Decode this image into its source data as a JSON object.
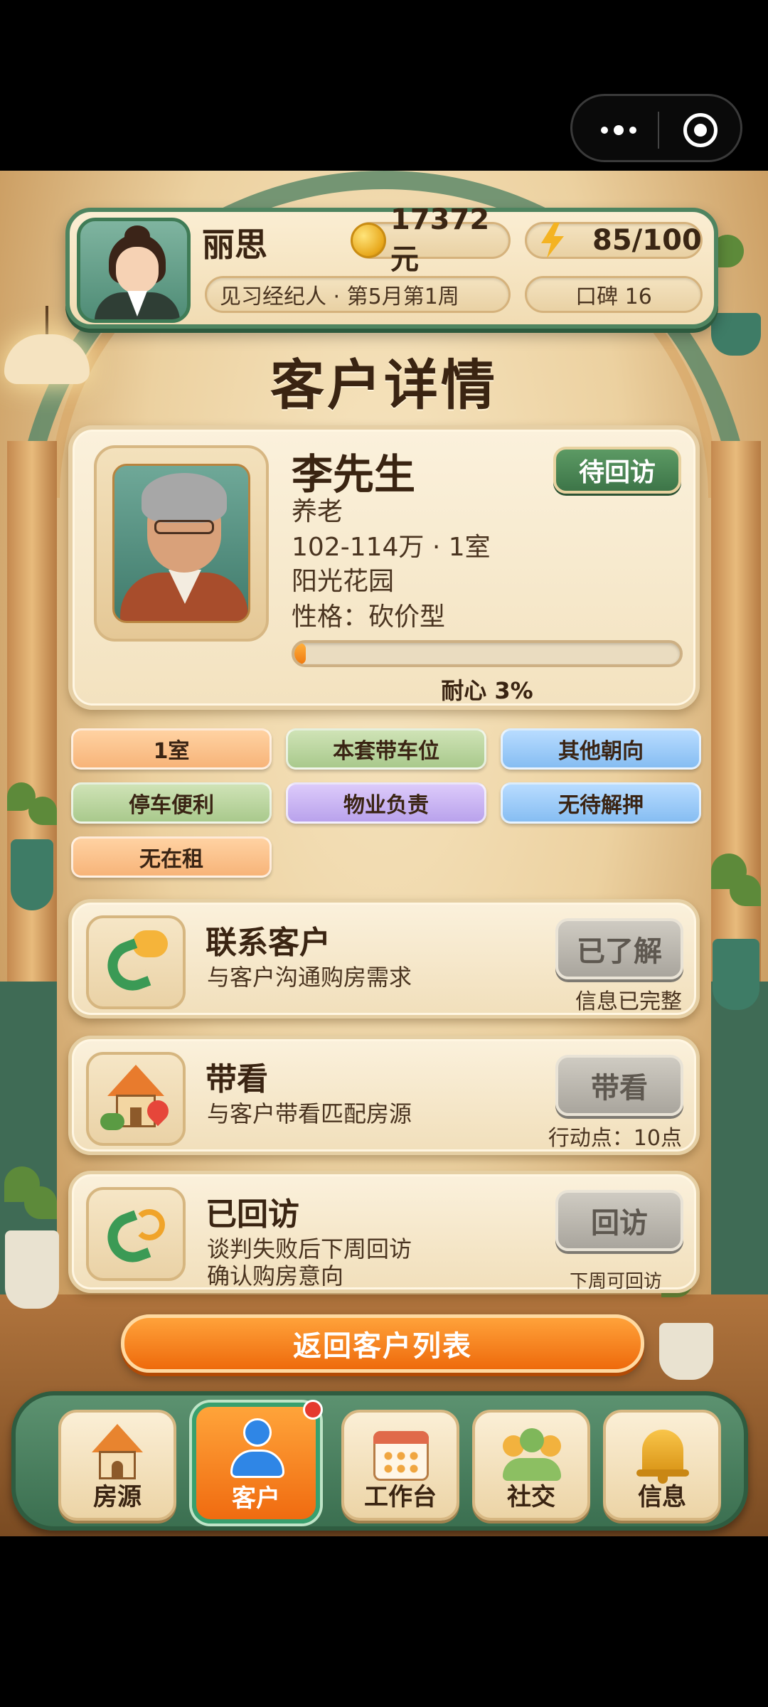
{
  "header": {
    "player_name": "丽思",
    "coins": "17372元",
    "energy": "85/100",
    "rank": "见习经纪人 · 第5月第1周",
    "reputation": "口碑 16"
  },
  "page_title": "客户详情",
  "client": {
    "name": "李先生",
    "purpose": "养老",
    "budget": "102-114万 · 1室",
    "community": "阳光花园",
    "personality": "性格：砍价型",
    "status": "待回访",
    "patience_label": "耐心 3%",
    "patience_value": 0.03
  },
  "tags": [
    {
      "label": "1室",
      "color": "orange"
    },
    {
      "label": "本套带车位",
      "color": "green"
    },
    {
      "label": "其他朝向",
      "color": "blue"
    },
    {
      "label": "停车便利",
      "color": "green"
    },
    {
      "label": "物业负责",
      "color": "purple"
    },
    {
      "label": "无待解押",
      "color": "blue"
    },
    {
      "label": "无在租",
      "color": "orange"
    }
  ],
  "actions": {
    "contact": {
      "title": "联系客户",
      "desc": "与客户沟通购房需求",
      "button": "已了解",
      "sub": "信息已完整"
    },
    "viewing": {
      "title": "带看",
      "desc": "与客户带看匹配房源",
      "button": "带看",
      "sub": "行动点：10点"
    },
    "revisit": {
      "title": "已回访",
      "desc1": "谈判失败后下周回访",
      "desc2": "确认购房意向",
      "button": "回访",
      "sub": "下周可回访"
    }
  },
  "return_button": "返回客户列表",
  "nav": {
    "listings": "房源",
    "clients": "客户",
    "workbench": "工作台",
    "social": "社交",
    "messages": "信息"
  },
  "colors": {
    "accent_orange": "#f07a10",
    "green_frame": "#4e8460",
    "status_green": "#3d7548"
  }
}
